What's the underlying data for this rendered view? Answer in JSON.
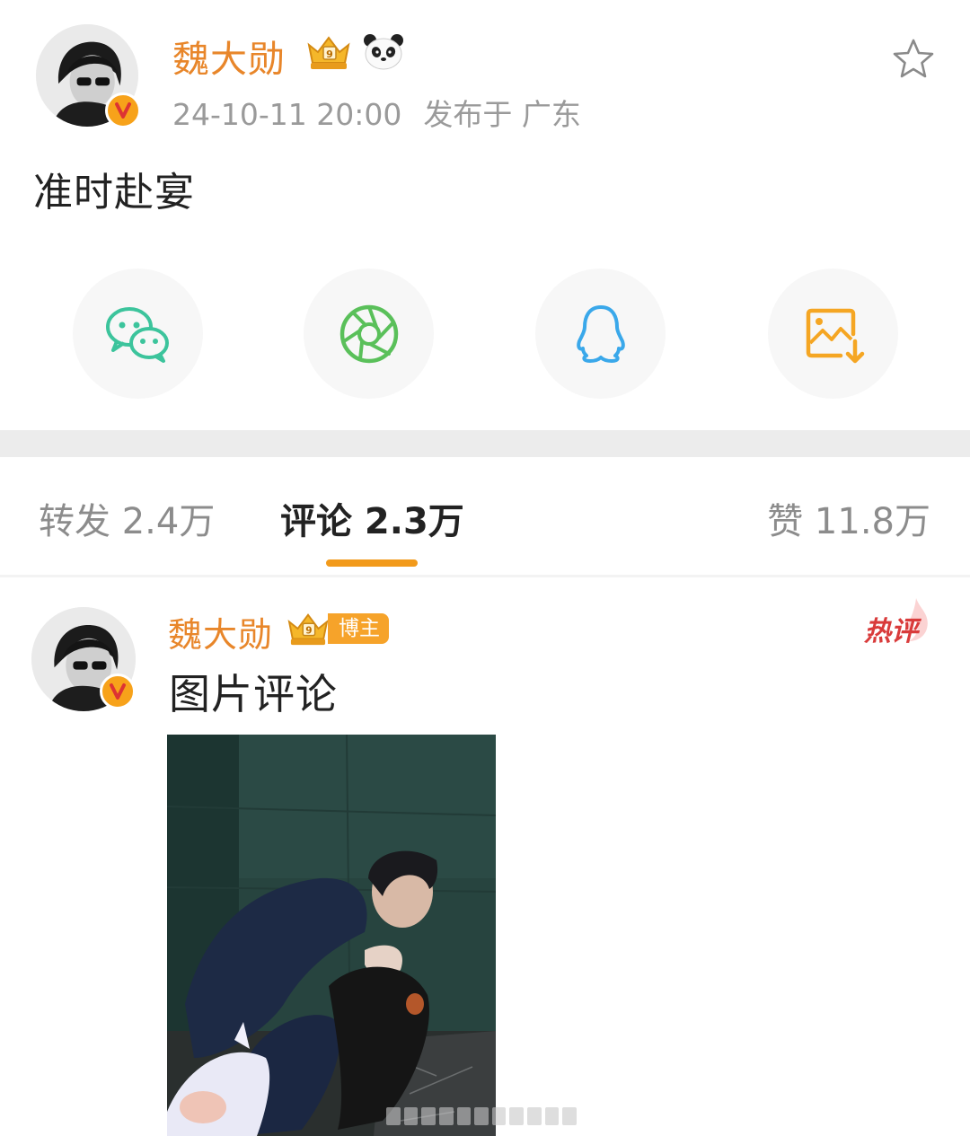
{
  "post": {
    "author": "魏大勋",
    "timestamp": "24-10-11 20:00",
    "location": "发布于 广东",
    "text": "准时赴宴",
    "verified_badge": "V",
    "icons": [
      "crown-level-icon",
      "panda-emoji-icon",
      "star-favorite-icon"
    ]
  },
  "share": {
    "items": [
      {
        "name": "wechat-icon",
        "color": "#3cc49c"
      },
      {
        "name": "moments-shutter-icon",
        "color": "#5ac05a"
      },
      {
        "name": "qq-penguin-icon",
        "color": "#3aa8ea"
      },
      {
        "name": "save-image-icon",
        "color": "#f5a623"
      }
    ]
  },
  "tabs": {
    "repost": "转发 2.4万",
    "comment": "评论 2.3万",
    "like": "赞 11.8万",
    "active": "comment",
    "accent": "#f29a1b"
  },
  "comment": {
    "author": "魏大勋",
    "blogger_tag": "博主",
    "hot_label": "热评",
    "text": "图片评论"
  },
  "colors": {
    "name_orange": "#e8862a",
    "meta_gray": "#9a9a9a",
    "hot_red": "#d93b3b"
  }
}
